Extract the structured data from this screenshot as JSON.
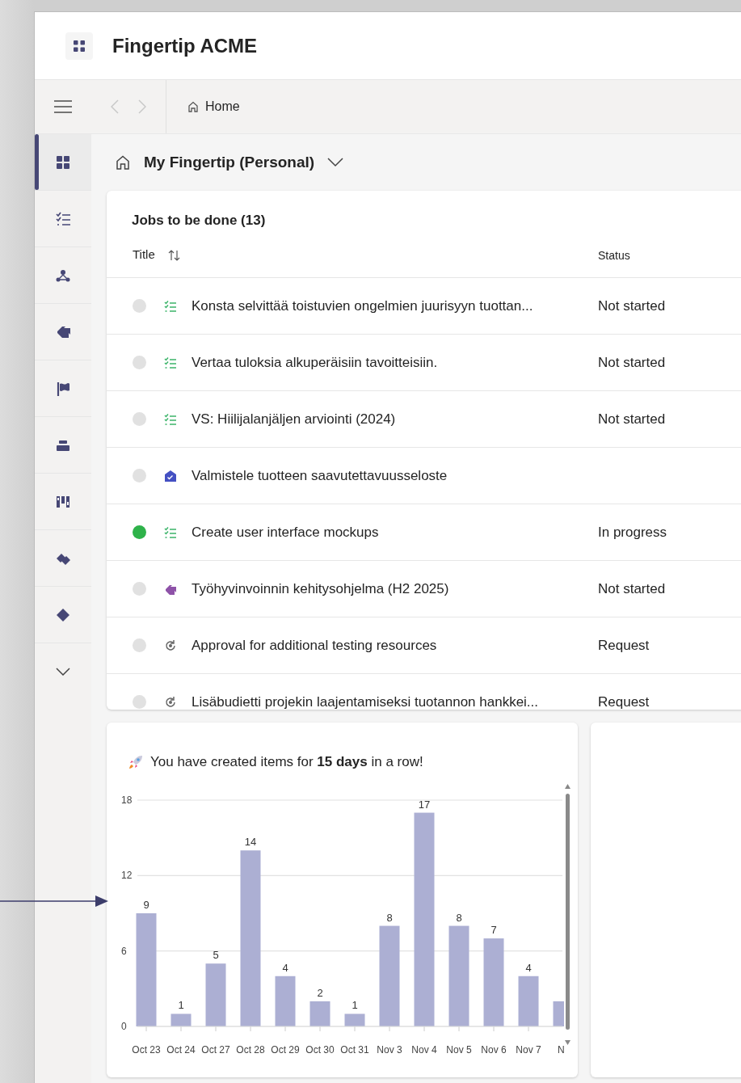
{
  "app": {
    "title": "Fingertip ACME"
  },
  "toolbar": {
    "breadcrumb": "Home",
    "back_disabled": true,
    "forward_disabled": true
  },
  "sidebar": {
    "items": [
      {
        "kind": "dashboard",
        "selected": true
      },
      {
        "kind": "tasks",
        "selected": false
      },
      {
        "kind": "network",
        "selected": false
      },
      {
        "kind": "goal",
        "selected": false
      },
      {
        "kind": "flag",
        "selected": false
      },
      {
        "kind": "stack",
        "selected": false
      },
      {
        "kind": "board",
        "selected": false
      },
      {
        "kind": "tags",
        "selected": false
      },
      {
        "kind": "diamond",
        "selected": false
      }
    ]
  },
  "page": {
    "title": "My Fingertip (Personal)"
  },
  "jobs": {
    "title": "Jobs to be done (13)",
    "columns": [
      "Title",
      "Status"
    ],
    "rows": [
      {
        "color": "#e1e1e1",
        "kind": "task",
        "title": "Konsta selvittää toistuvien ongelmien juurisyyn tuottan...",
        "status": "Not started"
      },
      {
        "color": "#e1e1e1",
        "kind": "task",
        "title": "Vertaa tuloksia alkuperäisiin tavoitteisiin.",
        "status": "Not started"
      },
      {
        "color": "#e1e1e1",
        "kind": "task",
        "title": "VS: Hiilijalanjäljen arviointi (2024)",
        "status": "Not started"
      },
      {
        "color": "#e1e1e1",
        "kind": "milestone",
        "title": "Valmistele tuotteen saavutettavuusseloste"
      },
      {
        "color": "#2eb24a",
        "kind": "task",
        "title": "Create user interface mockups",
        "status": "In progress"
      },
      {
        "color": "#e1e1e1",
        "kind": "goal",
        "title": "Työhyvinvoinnin kehitysohjelma (H2 2025)",
        "status": "Not started"
      },
      {
        "color": "#e1e1e1",
        "kind": "request",
        "title": "Approval for additional testing resources",
        "status": "Request"
      },
      {
        "color": "#e1e1e1",
        "kind": "request",
        "title": "Lisäbudietti projekin laajentamiseksi tuotannon hankkei...",
        "status": "Request"
      }
    ]
  },
  "streak": {
    "message": "You have created items for **15 days** in a row!",
    "chart_data": {
      "type": "bar",
      "categories": [
        "Oct 23",
        "Oct 24",
        "Oct 27",
        "Oct 28",
        "Oct 29",
        "Oct 30",
        "Oct 31",
        "Nov 3",
        "Nov 4",
        "Nov 5",
        "Nov 6",
        "Nov 7",
        "N"
      ],
      "series": [
        {
          "color": "#acafd3",
          "values": [
            9,
            1,
            5,
            14,
            4,
            2,
            1,
            8,
            17,
            8,
            7,
            4,
            2
          ]
        }
      ],
      "ylim": [
        0,
        18
      ],
      "yticks": [
        0,
        6,
        12,
        18
      ],
      "value_labels": [
        "9",
        "1",
        "5",
        "14",
        "4",
        "2",
        "1",
        "8",
        "17",
        "8",
        "7",
        "4",
        null
      ]
    }
  }
}
